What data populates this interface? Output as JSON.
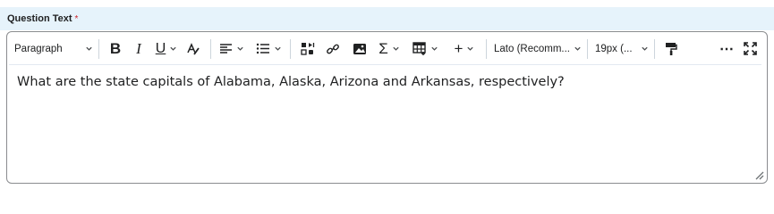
{
  "field": {
    "label": "Question Text",
    "required_marker": "*"
  },
  "toolbar": {
    "block_format": "Paragraph",
    "bold": "B",
    "italic": "I",
    "underline": "U",
    "equation_symbol": "Σ",
    "insert_plus": "+",
    "font_family": "Lato (Recomm...",
    "font_size": "19px (...",
    "more": "⋯"
  },
  "editor": {
    "content": "What are the state capitals of Alabama, Alaska, Arizona and Arkansas, respectively?"
  },
  "icons": {
    "chevron": "chevron-down-icon",
    "format_painter": "paint-roller-icon",
    "fullscreen": "fullscreen-icon"
  }
}
